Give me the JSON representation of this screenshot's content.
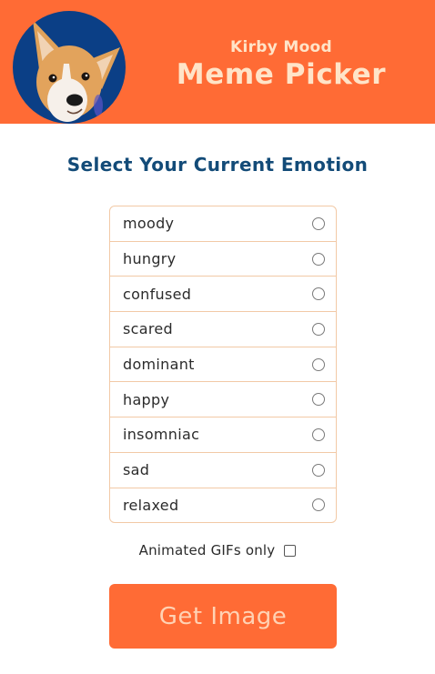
{
  "header": {
    "subtitle": "Kirby Mood",
    "title": "Meme Picker",
    "avatar_icon": "corgi-dog-icon",
    "colors": {
      "banner": "#ff6b35",
      "avatar_bg": "#0b3f86",
      "title_text": "#ffe4c8"
    }
  },
  "main": {
    "heading": "Select Your Current Emotion",
    "emotions": [
      {
        "label": "moody"
      },
      {
        "label": "hungry"
      },
      {
        "label": "confused"
      },
      {
        "label": "scared"
      },
      {
        "label": "dominant"
      },
      {
        "label": "happy"
      },
      {
        "label": "insomniac"
      },
      {
        "label": "sad"
      },
      {
        "label": "relaxed"
      }
    ],
    "gifs_only_label": "Animated GIFs only",
    "gifs_only_checked": false,
    "submit_label": "Get Image"
  }
}
